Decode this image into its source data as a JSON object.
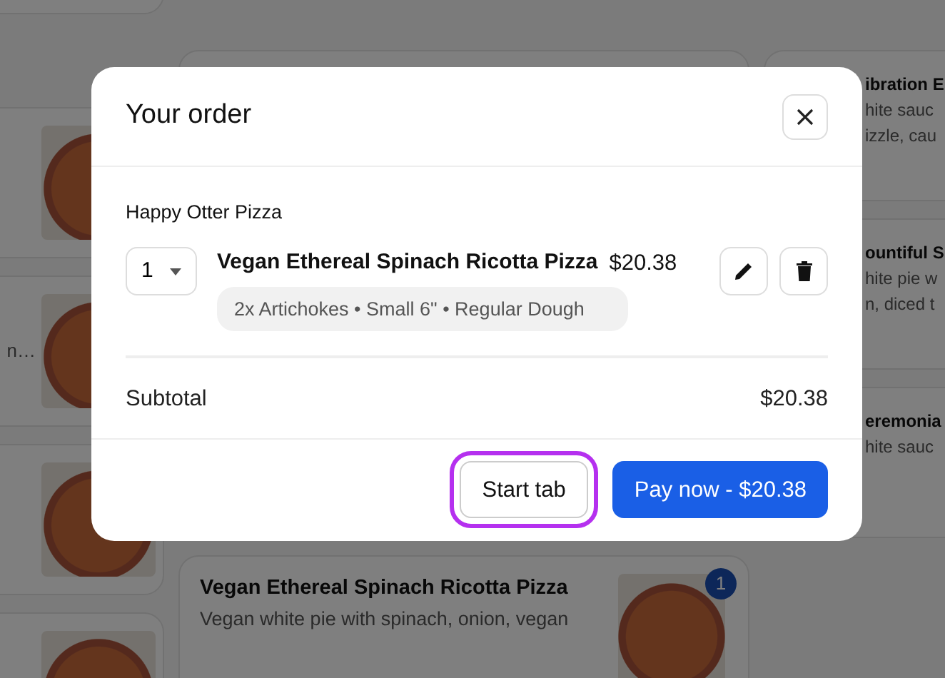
{
  "background": {
    "left_card_text": "n…",
    "middle_card": {
      "title": "Vegan Ethereal Spinach Ricotta Pizza",
      "description": "Vegan white pie with spinach, onion, vegan",
      "badge": "1"
    },
    "right_cards": [
      {
        "lines": [
          "ibration E",
          "hite sauc",
          "izzle, cau"
        ]
      },
      {
        "lines": [
          "ountiful S",
          "hite pie w",
          "n, diced t"
        ]
      },
      {
        "lines": [
          "eremonia",
          "hite sauc"
        ]
      }
    ]
  },
  "modal": {
    "title": "Your order",
    "restaurant": "Happy Otter Pizza",
    "items": [
      {
        "quantity": "1",
        "name": "Vegan Ethereal Spinach Ricotta Pizza",
        "price": "$20.38",
        "options": "2x Artichokes • Small 6\" • Regular Dough"
      }
    ],
    "subtotal_label": "Subtotal",
    "subtotal": "$20.38",
    "buttons": [
      {
        "label": "Start tab",
        "kind": "secondary",
        "focused": true
      },
      {
        "label": "Pay now - $20.38",
        "kind": "primary",
        "focused": false
      }
    ]
  }
}
